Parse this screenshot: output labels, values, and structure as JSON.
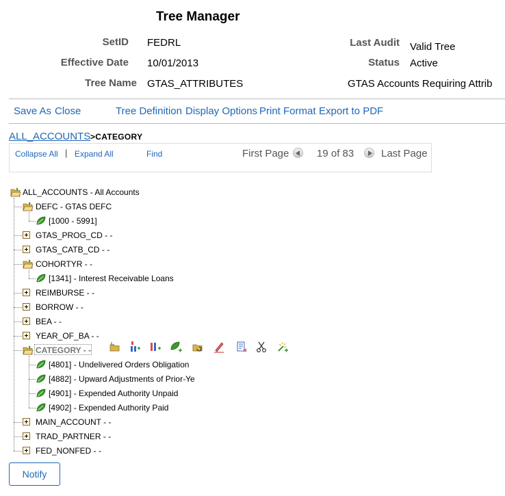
{
  "page": {
    "title": "Tree Manager"
  },
  "fields": {
    "setid_label": "SetID",
    "setid_value": "FEDRL",
    "effdate_label": "Effective Date",
    "effdate_value": "10/01/2013",
    "treename_label": "Tree Name",
    "treename_value": "GTAS_ATTRIBUTES",
    "lastaudit_label": "Last Audit",
    "lastaudit_value": "Valid Tree",
    "status_label": "Status",
    "status_value": "Active",
    "description": "GTAS Accounts Requiring Attrib"
  },
  "toolbar": {
    "save_as": "Save As",
    "close": "Close",
    "tree_definition": "Tree Definition",
    "display_options": "Display Options",
    "print_format": "Print Format",
    "export_pdf": "Export to PDF"
  },
  "breadcrumb": {
    "root": "ALL_ACCOUNTS",
    "current": ">CATEGORY"
  },
  "nav": {
    "collapse_all": "Collapse All",
    "separator": "|",
    "expand_all": "Expand All",
    "find": "Find",
    "first_page": "First Page",
    "page_info": "19 of 83",
    "last_page": "Last Page"
  },
  "tree": {
    "root": "ALL_ACCOUNTS - All Accounts",
    "nodes": [
      {
        "label": "DEFC - GTAS DEFC",
        "type": "open"
      },
      {
        "label": "[1000 - 5991]",
        "type": "leaf"
      },
      {
        "label": "GTAS_PROG_CD - -",
        "type": "closed"
      },
      {
        "label": "GTAS_CATB_CD - -",
        "type": "closed"
      },
      {
        "label": "COHORTYR - -",
        "type": "open"
      },
      {
        "label": "[1341] - Interest Receivable Loans",
        "type": "leaf"
      },
      {
        "label": "REIMBURSE - -",
        "type": "closed"
      },
      {
        "label": "BORROW - -",
        "type": "closed"
      },
      {
        "label": "BEA - -",
        "type": "closed"
      },
      {
        "label": "YEAR_OF_BA - -",
        "type": "closed"
      },
      {
        "label": "CATEGORY - -",
        "type": "open-selected"
      },
      {
        "label": "[4801] - Undelivered Orders Obligation",
        "type": "leaf"
      },
      {
        "label": "[4882] - Upward Adjustments of Prior-Ye",
        "type": "leaf"
      },
      {
        "label": "[4901] - Expended Authority Unpaid",
        "type": "leaf"
      },
      {
        "label": "[4902] - Expended Authority Paid",
        "type": "leaf"
      },
      {
        "label": "MAIN_ACCOUNT - -",
        "type": "closed"
      },
      {
        "label": "TRAD_PARTNER - -",
        "type": "closed"
      },
      {
        "label": "FED_NONFED - -",
        "type": "closed"
      }
    ]
  },
  "node_tools": [
    "insert-child-node-icon",
    "insert-sibling-node-icon",
    "insert-child-detail-icon",
    "insert-leaf-icon",
    "edit-data-icon",
    "edit-node-icon",
    "delete-icon",
    "cut-icon",
    "paste-icon"
  ],
  "colors": {
    "link": "#2067b8",
    "folder": "#d9b54a",
    "leaf": "#3a9a2a"
  },
  "buttons": {
    "notify": "Notify"
  }
}
